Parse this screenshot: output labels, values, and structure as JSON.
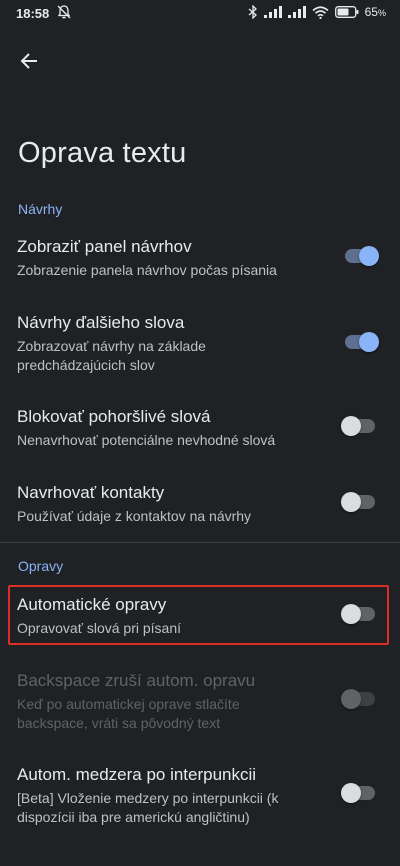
{
  "status_bar": {
    "time": "18:58",
    "battery_percent": "65",
    "battery_suffix": "%",
    "icons": [
      "mute-bell-icon",
      "bluetooth-icon",
      "signal-icon",
      "signal-icon",
      "wifi-icon",
      "battery-icon"
    ]
  },
  "header": {
    "back_icon": "arrow-left-icon"
  },
  "page": {
    "title": "Oprava textu"
  },
  "sections": [
    {
      "label": "Návrhy"
    },
    {
      "label": "Opravy"
    }
  ],
  "settings": [
    {
      "title": "Zobraziť panel návrhov",
      "subtitle": "Zobrazenie panela návrhov počas písania",
      "enabled": true,
      "state": true
    },
    {
      "title": "Návrhy ďalšieho slova",
      "subtitle": "Zobrazovať návrhy na základe predchádzajúcich slov",
      "enabled": true,
      "state": true
    },
    {
      "title": "Blokovať pohoršlivé slová",
      "subtitle": "Nenavrhovať potenciálne nevhodné slová",
      "enabled": true,
      "state": false
    },
    {
      "title": "Navrhovať kontakty",
      "subtitle": "Používať údaje z kontaktov na návrhy",
      "enabled": true,
      "state": false
    },
    {
      "title": "Automatické opravy",
      "subtitle": "Opravovať slová pri písaní",
      "enabled": true,
      "state": false,
      "highlighted": true
    },
    {
      "title": "Backspace zruší autom. opravu",
      "subtitle": "Keď po automatickej oprave stlačíte backspace, vráti sa pôvodný text",
      "enabled": false,
      "state": false
    },
    {
      "title": "Autom. medzera po interpunkcii",
      "subtitle": "[Beta] Vloženie medzery po interpunkcii (k dispozícii iba pre americkú angličtinu)",
      "enabled": true,
      "state": false
    }
  ],
  "colors": {
    "accent": "#8ab4f8",
    "highlight_border": "#d93025",
    "background": "#202124"
  }
}
